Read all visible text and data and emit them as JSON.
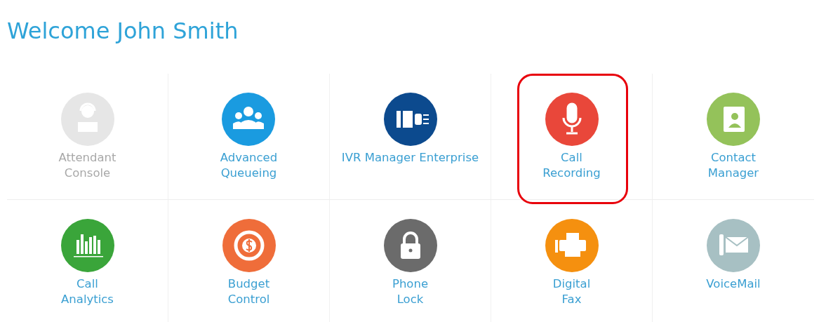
{
  "title": "Welcome John Smith",
  "apps": [
    {
      "label_lines": [
        "Attendant",
        "Console"
      ],
      "kind": "agent",
      "color": "#e6e6e6",
      "disabled": true,
      "highlighted": false
    },
    {
      "label_lines": [
        "Advanced",
        "Queueing"
      ],
      "kind": "group",
      "color": "#1a9be0",
      "disabled": false,
      "highlighted": false
    },
    {
      "label_lines": [
        "IVR Manager Enterprise"
      ],
      "kind": "ivr",
      "color": "#0c4a8e",
      "disabled": false,
      "highlighted": false
    },
    {
      "label_lines": [
        "Call",
        "Recording"
      ],
      "kind": "microphone",
      "color": "#e9473a",
      "disabled": false,
      "highlighted": true
    },
    {
      "label_lines": [
        "Contact",
        "Manager"
      ],
      "kind": "contact",
      "color": "#94c25a",
      "disabled": false,
      "highlighted": false
    },
    {
      "label_lines": [
        "Call",
        "Analytics"
      ],
      "kind": "chart",
      "color": "#3aa53a",
      "disabled": false,
      "highlighted": false
    },
    {
      "label_lines": [
        "Budget",
        "Control"
      ],
      "kind": "dollar",
      "color": "#ef6d3a",
      "disabled": false,
      "highlighted": false
    },
    {
      "label_lines": [
        "Phone",
        "Lock"
      ],
      "kind": "lock",
      "color": "#6b6b6b",
      "disabled": false,
      "highlighted": false
    },
    {
      "label_lines": [
        "Digital",
        "Fax"
      ],
      "kind": "fax",
      "color": "#f5900f",
      "disabled": false,
      "highlighted": false
    },
    {
      "label_lines": [
        "VoiceMail"
      ],
      "kind": "voicemail",
      "color": "#a7c0c3",
      "disabled": false,
      "highlighted": false
    }
  ]
}
